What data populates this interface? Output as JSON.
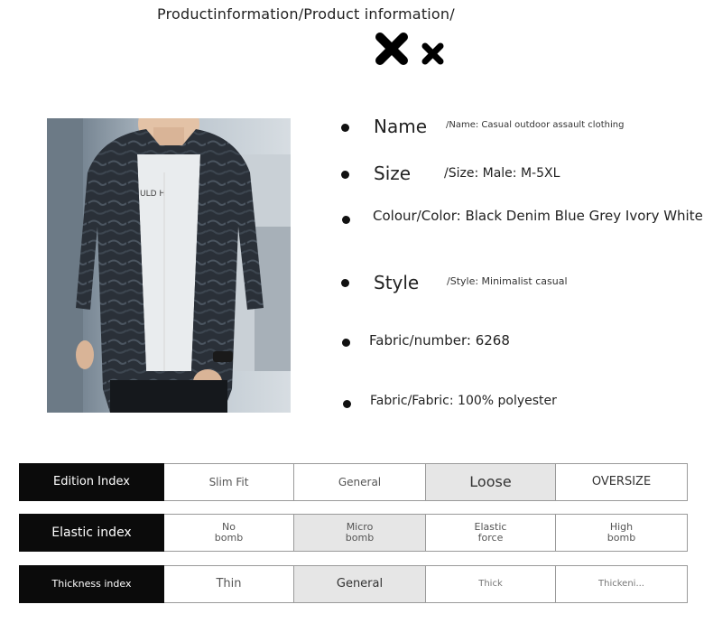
{
  "header": {
    "title": "Productinformation/Product information/"
  },
  "product": {
    "image_alt": "Man wearing dark patterned hooded jacket",
    "attributes": [
      {
        "label": "Name",
        "value": "/Name: Casual outdoor assault clothing"
      },
      {
        "label": "Size",
        "value": "/Size: Male: M-5XL"
      },
      {
        "label": "Colour/Color: Black Denim Blue Grey Ivory White"
      },
      {
        "label": "Style",
        "value": "/Style: Minimalist casual"
      },
      {
        "label": "Fabric/number: 6268"
      },
      {
        "label": "Fabric/Fabric: 100% polyester"
      }
    ]
  },
  "indexes": [
    {
      "name": "Edition Index",
      "options": [
        "Slim Fit",
        "General",
        "Loose",
        "OVERSIZE"
      ],
      "selected": 2
    },
    {
      "name": "Elastic index",
      "options": [
        [
          "No",
          "bomb"
        ],
        [
          "Micro",
          "bomb"
        ],
        [
          "Elastic",
          "force"
        ],
        [
          "High",
          "bomb"
        ]
      ],
      "selected": 1
    },
    {
      "name": "Thickness index",
      "options": [
        "Thin",
        "General",
        "Thick",
        "Thickeni..."
      ],
      "selected": 1
    }
  ],
  "colors": {
    "header_cell": "#0b0b0b",
    "selected_cell": "#e6e6e6",
    "border": "#9a9a9a"
  },
  "icons": [
    "large-x-icon",
    "small-x-icon"
  ]
}
